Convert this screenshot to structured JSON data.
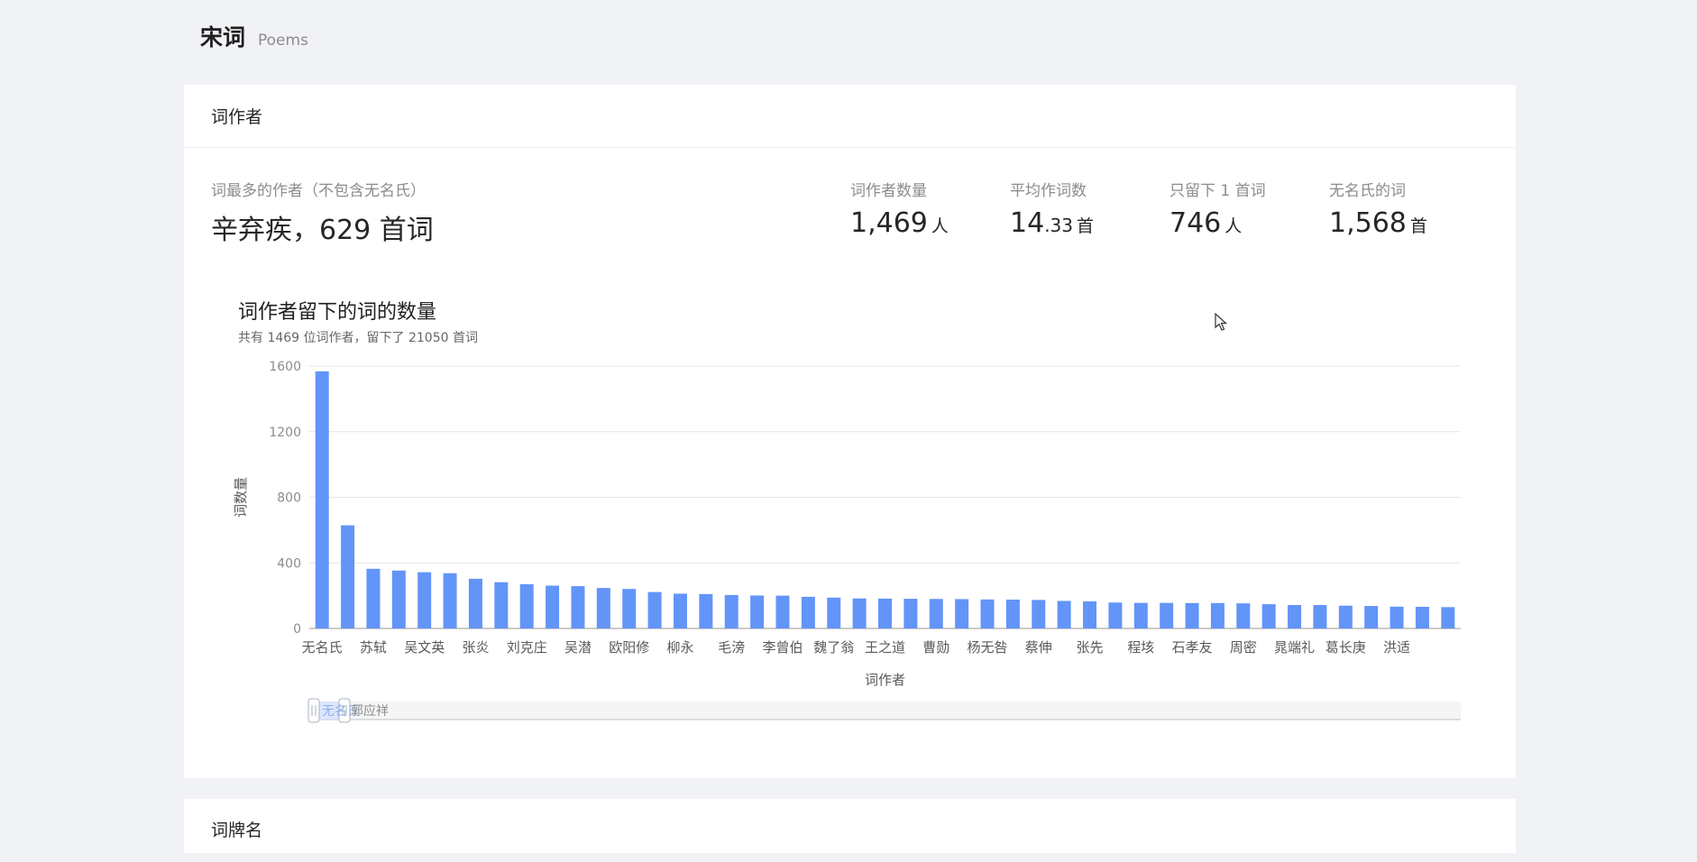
{
  "header": {
    "title": "宋词",
    "subtitle": "Poems"
  },
  "authors_card": {
    "title": "词作者",
    "top_author": {
      "label": "词最多的作者（不包含无名氏）",
      "value": "辛弃疾，629 首词"
    },
    "stats": [
      {
        "label": "词作者数量",
        "value": "1,469",
        "unit": "人"
      },
      {
        "label": "平均作词数",
        "value": "14",
        "decimal": ".33",
        "unit": "首"
      },
      {
        "label": "只留下 1 首词",
        "value": "746",
        "unit": "人"
      },
      {
        "label": "无名氏的词",
        "value": "1,568",
        "unit": "首"
      }
    ]
  },
  "next_card": {
    "title": "词牌名"
  },
  "colors": {
    "bar": "#6394f8",
    "background": "#f0f2f5"
  },
  "chart_data": {
    "type": "bar",
    "title": "词作者留下的词的数量",
    "subtitle": "共有 1469 位词作者，留下了 21050 首词",
    "xlabel": "词作者",
    "ylabel": "词数量",
    "ylim": [
      0,
      1600
    ],
    "yticks": [
      0,
      400,
      800,
      1200,
      1600
    ],
    "grid": true,
    "categories": [
      "无名氏",
      "",
      "苏轼",
      "",
      "吴文英",
      "",
      "张炎",
      "",
      "刘克庄",
      "",
      "吴潜",
      "",
      "欧阳修",
      "",
      "柳永",
      "",
      "毛滂",
      "",
      "李曾伯",
      "",
      "魏了翁",
      "",
      "王之道",
      "",
      "曹勋",
      "",
      "杨无咎",
      "",
      "蔡伸",
      "",
      "张先",
      "",
      "程垓",
      "",
      "石孝友",
      "",
      "周密",
      "",
      "晁端礼",
      "",
      "葛长庚",
      "",
      "洪适",
      ""
    ],
    "values": [
      1568,
      629,
      364,
      353,
      343,
      337,
      303,
      282,
      270,
      261,
      258,
      247,
      241,
      222,
      212,
      210,
      204,
      201,
      200,
      193,
      188,
      183,
      182,
      181,
      180,
      179,
      177,
      176,
      174,
      168,
      165,
      158,
      156,
      156,
      155,
      155,
      153,
      148,
      143,
      143,
      139,
      137,
      133,
      132,
      130
    ],
    "slider": {
      "start_label": "无名氏",
      "end_label": "郭应祥"
    }
  }
}
